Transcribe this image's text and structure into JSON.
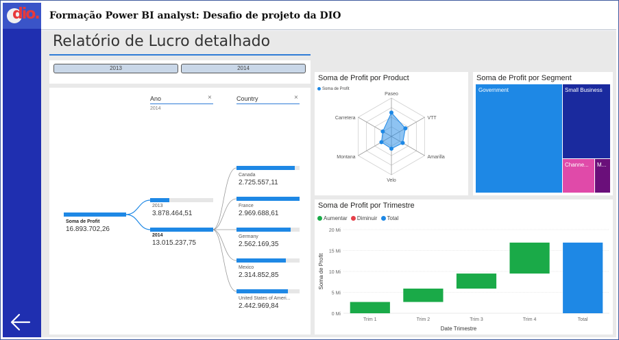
{
  "header": {
    "title": "Formação Power BI analyst: Desafio de projeto da DIO"
  },
  "logo": {
    "text": "dio."
  },
  "report": {
    "title": "Relatório de Lucro detalhado"
  },
  "slicer": {
    "options": [
      "2013",
      "2014"
    ]
  },
  "decomposition": {
    "root": {
      "label": "Soma de Profit",
      "value": "16.893.702,26"
    },
    "levels": [
      {
        "title": "Ano",
        "filter": "2014"
      },
      {
        "title": "Country"
      }
    ],
    "years": [
      {
        "label": "2013",
        "value": "3.878.464,51",
        "share": 0.3
      },
      {
        "label": "2014",
        "value": "13.015.237,75",
        "share": 1.0
      }
    ],
    "countries": [
      {
        "label": "Canada",
        "value": "2.725.557,11",
        "share": 0.92
      },
      {
        "label": "France",
        "value": "2.969.688,61",
        "share": 1.0
      },
      {
        "label": "Germany",
        "value": "2.562.169,35",
        "share": 0.86
      },
      {
        "label": "Mexico",
        "value": "2.314.852,85",
        "share": 0.78
      },
      {
        "label": "United States of Ameri...",
        "value": "2.442.969,84",
        "share": 0.82
      }
    ]
  },
  "radar": {
    "title": "Soma de Profit por Product",
    "legend": "Soma de Profit",
    "color": "#1e88e5",
    "axes": [
      "Paseo",
      "VTT",
      "Amarilla",
      "Velo",
      "Montana",
      "Carretera"
    ],
    "values": [
      0.62,
      0.42,
      0.34,
      0.32,
      0.3,
      0.26
    ]
  },
  "treemap": {
    "title": "Soma de Profit por Segment",
    "segments": [
      {
        "label": "Government",
        "color": "#1e88e5"
      },
      {
        "label": "Small Business",
        "color": "#1a2a9e"
      },
      {
        "label": "Channe...",
        "color": "#e04aa9"
      },
      {
        "label": "M...",
        "color": "#6a0f7a"
      }
    ]
  },
  "waterfall": {
    "title": "Soma de Profit por Trimestre",
    "legend": [
      {
        "label": "Aumentar",
        "color": "#1aaa48"
      },
      {
        "label": "Diminuir",
        "color": "#e5404a"
      },
      {
        "label": "Total",
        "color": "#1e88e5"
      }
    ],
    "ylabel": "Soma de Profit",
    "xlabel": "Date Trimestre",
    "yticks": [
      "0 Mi",
      "5 Mi",
      "10 Mi",
      "15 Mi",
      "20 Mi"
    ]
  },
  "chart_data": {
    "type": "bar",
    "title": "Soma de Profit por Trimestre",
    "subtype": "waterfall",
    "categories": [
      "Trim 1",
      "Trim 2",
      "Trim 3",
      "Trim 4",
      "Total"
    ],
    "values": [
      2.7,
      3.2,
      3.6,
      7.4,
      16.9
    ],
    "xlabel": "Date Trimestre",
    "ylabel": "Soma de Profit",
    "ylim": [
      0,
      20
    ],
    "unit": "Mi",
    "grid": true,
    "legend_position": "top-left"
  }
}
